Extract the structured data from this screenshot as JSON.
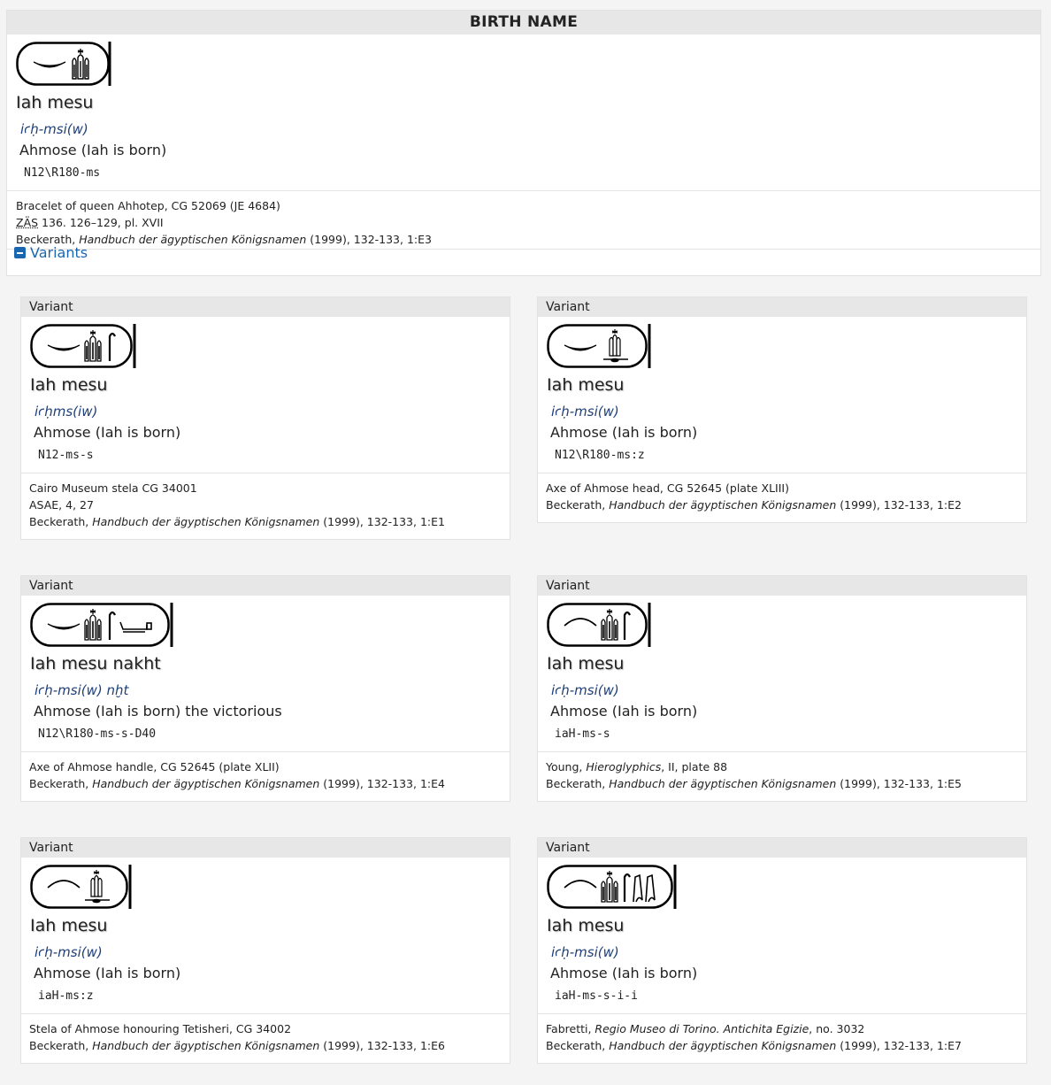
{
  "main": {
    "header": "BIRTH NAME",
    "name": "Iah mesu",
    "translit": "iꜥḥ-msi(w)",
    "meaning": "Ahmose (Iah is born)",
    "mdc": "N12\\R180-ms",
    "refs": [
      {
        "pre": "Bracelet of queen Ahhotep, CG 52069 (JE 4684)",
        "ital": "",
        "post": ""
      },
      {
        "abbr": "ZÄS",
        "pre": " 136. 126–129, pl. XVII",
        "ital": "",
        "post": ""
      },
      {
        "pre": "Beckerath, ",
        "ital": "Handbuch der ägyptischen Königsnamen",
        "post": " (1999), 132-133, 1:E3"
      }
    ],
    "variants_label": "Variants"
  },
  "variant_header": "Variant",
  "variants": [
    {
      "name": "Iah mesu",
      "translit": "iꜥḥms(iw)",
      "meaning": "Ahmose (Iah is born)",
      "mdc": "N12-ms-s",
      "refs": [
        {
          "pre": "Cairo Museum stela CG 34001",
          "ital": "",
          "post": ""
        },
        {
          "pre": "ASAE, 4, 27",
          "ital": "",
          "post": ""
        },
        {
          "pre": "Beckerath, ",
          "ital": "Handbuch der ägyptischen Königsnamen",
          "post": " (1999), 132-133, 1:E1"
        }
      ]
    },
    {
      "name": "Iah mesu",
      "translit": "iꜥḥ-msi(w)",
      "meaning": "Ahmose (Iah is born)",
      "mdc": "N12\\R180-ms:z",
      "refs": [
        {
          "pre": "Axe of Ahmose head, CG 52645 (plate XLIII)",
          "ital": "",
          "post": ""
        },
        {
          "pre": "Beckerath, ",
          "ital": "Handbuch der ägyptischen Königsnamen",
          "post": " (1999), 132-133, 1:E2"
        }
      ]
    },
    {
      "name": "Iah mesu nakht",
      "translit": "iꜥḥ-msi(w) nḫt",
      "meaning": "Ahmose (Iah is born) the victorious",
      "mdc": "N12\\R180-ms-s-D40",
      "refs": [
        {
          "pre": "Axe of Ahmose handle, CG 52645 (plate XLII)",
          "ital": "",
          "post": ""
        },
        {
          "pre": "Beckerath, ",
          "ital": "Handbuch der ägyptischen Königsnamen",
          "post": " (1999), 132-133, 1:E4"
        }
      ]
    },
    {
      "name": "Iah mesu",
      "translit": "iꜥḥ-msi(w)",
      "meaning": "Ahmose (Iah is born)",
      "mdc": "iaH-ms-s",
      "refs": [
        {
          "pre": "Young, ",
          "ital": "Hieroglyphics",
          "post": ", II, plate 88"
        },
        {
          "pre": "Beckerath, ",
          "ital": "Handbuch der ägyptischen Königsnamen",
          "post": " (1999), 132-133, 1:E5"
        }
      ]
    },
    {
      "name": "Iah mesu",
      "translit": "iꜥḥ-msi(w)",
      "meaning": "Ahmose (Iah is born)",
      "mdc": "iaH-ms:z",
      "refs": [
        {
          "pre": "Stela of Ahmose honouring Tetisheri, CG 34002",
          "ital": "",
          "post": ""
        },
        {
          "pre": "Beckerath, ",
          "ital": "Handbuch der ägyptischen Königsnamen",
          "post": " (1999), 132-133, 1:E6"
        }
      ]
    },
    {
      "name": "Iah mesu",
      "translit": "iꜥḥ-msi(w)",
      "meaning": "Ahmose (Iah is born)",
      "mdc": "iaH-ms-s-i-i",
      "refs": [
        {
          "pre": "Fabretti, ",
          "ital": "Regio Museo di Torino. Antichita Egizie",
          "post": ", no. 3032"
        },
        {
          "pre": "Beckerath, ",
          "ital": "Handbuch der ägyptischen Königsnamen",
          "post": " (1999), 132-133, 1:E7"
        }
      ]
    }
  ]
}
